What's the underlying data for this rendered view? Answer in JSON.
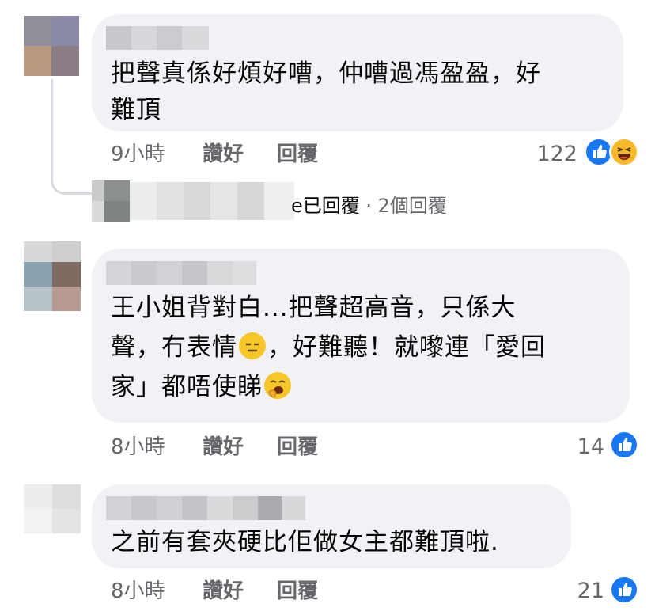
{
  "colors": {
    "bubble": "#f0f2f5",
    "meta_text": "#65676b",
    "like_blue": "#1877f2",
    "emoji_yellow": "#f7c72a"
  },
  "comments": [
    {
      "lines": [
        "把聲真係好煩好嘈，仲嘈過馮盈盈，好",
        "難頂"
      ],
      "time": "9小時",
      "like_label": "讚好",
      "reply_label": "回覆",
      "reaction_count": "122",
      "reactions": [
        "like-icon",
        "haha-icon"
      ]
    },
    {
      "lines": [
        "王小姐背對白...把聲超高音，只係大",
        "聲，冇表情",
        "，好難聽！就嚟連「愛回",
        "家」都唔使睇"
      ],
      "time": "8小時",
      "like_label": "讚好",
      "reply_label": "回覆",
      "reaction_count": "14",
      "reactions": [
        "like-icon"
      ],
      "inline_emojis": [
        "expressionless-face-emoji",
        "yawning-face-emoji"
      ]
    },
    {
      "lines": [
        "之前有套夾硬比佢做女主都難頂啦."
      ],
      "time": "8小時",
      "like_label": "讚好",
      "reply_label": "回覆",
      "reaction_count": "21",
      "reactions": [
        "like-icon"
      ]
    }
  ],
  "reply_summary": {
    "text": "e已回覆",
    "count": "· 2個回覆"
  }
}
